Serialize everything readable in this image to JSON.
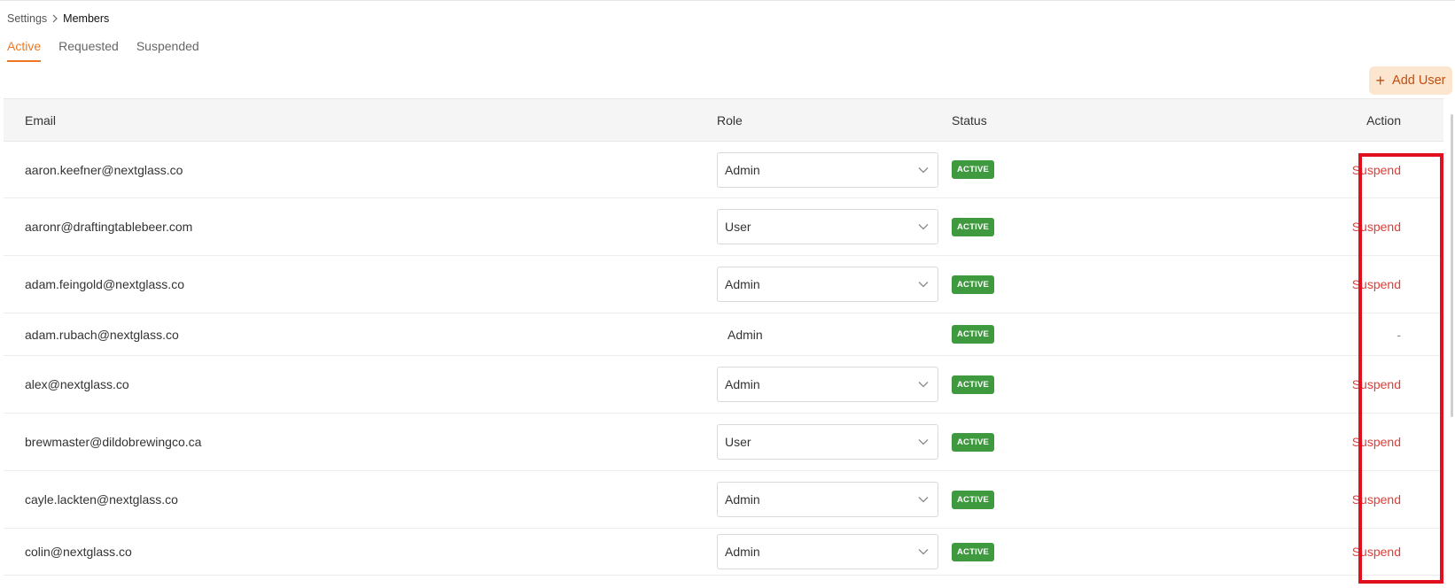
{
  "breadcrumb": {
    "parent": "Settings",
    "current": "Members"
  },
  "tabs": [
    {
      "label": "Active",
      "active": true
    },
    {
      "label": "Requested",
      "active": false
    },
    {
      "label": "Suspended",
      "active": false
    }
  ],
  "add_user_label": "Add User",
  "table": {
    "columns": {
      "email": "Email",
      "role": "Role",
      "status": "Status",
      "action": "Action"
    },
    "rows": [
      {
        "email": "aaron.keefner@nextglass.co",
        "role": "Admin",
        "role_editable": true,
        "status": "ACTIVE",
        "action": "Suspend"
      },
      {
        "email": "aaronr@draftingtablebeer.com",
        "role": "User",
        "role_editable": true,
        "status": "ACTIVE",
        "action": "Suspend"
      },
      {
        "email": "adam.feingold@nextglass.co",
        "role": "Admin",
        "role_editable": true,
        "status": "ACTIVE",
        "action": "Suspend"
      },
      {
        "email": "adam.rubach@nextglass.co",
        "role": "Admin",
        "role_editable": false,
        "status": "ACTIVE",
        "action": "-"
      },
      {
        "email": "alex@nextglass.co",
        "role": "Admin",
        "role_editable": true,
        "status": "ACTIVE",
        "action": "Suspend"
      },
      {
        "email": "brewmaster@dildobrewingco.ca",
        "role": "User",
        "role_editable": true,
        "status": "ACTIVE",
        "action": "Suspend"
      },
      {
        "email": "cayle.lackten@nextglass.co",
        "role": "Admin",
        "role_editable": true,
        "status": "ACTIVE",
        "action": "Suspend"
      },
      {
        "email": "colin@nextglass.co",
        "role": "Admin",
        "role_editable": true,
        "status": "ACTIVE",
        "action": "Suspend"
      }
    ]
  },
  "colors": {
    "accent": "#ee7722",
    "status_active": "#3f9a3f",
    "suspend": "#d9403a",
    "highlight": "#e0101f"
  }
}
